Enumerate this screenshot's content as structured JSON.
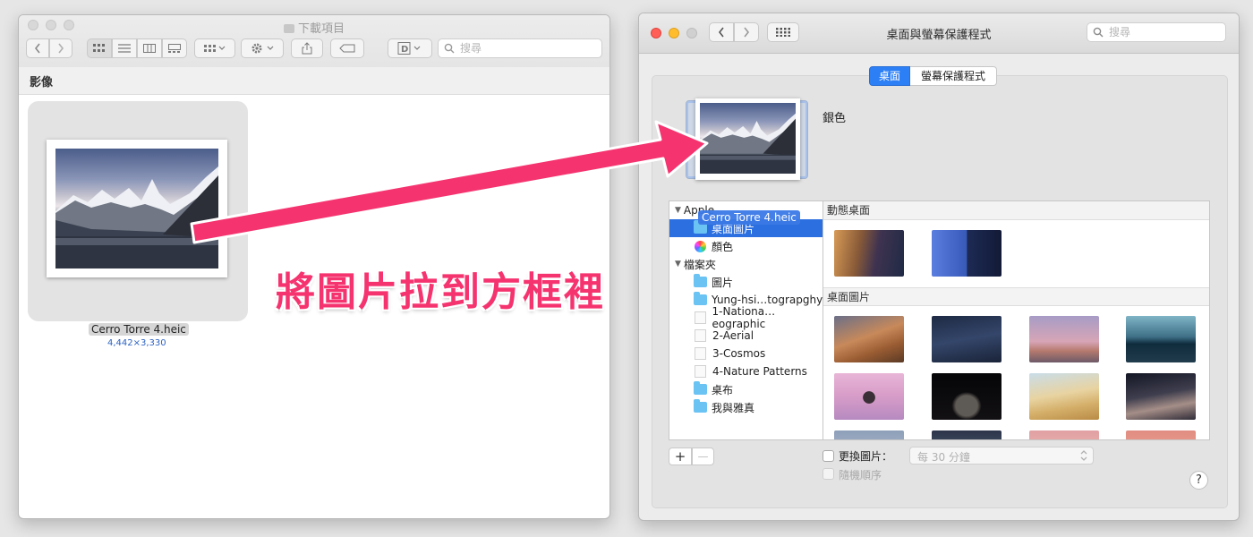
{
  "finder": {
    "title": "下載項目",
    "search_placeholder": "搜尋",
    "path_label": "影像",
    "file": {
      "name": "Cerro Torre 4.heic",
      "dimensions": "4,442×3,330"
    }
  },
  "annotation": {
    "text": "將圖片拉到方框裡",
    "color": "#f5336f"
  },
  "prefs": {
    "title": "桌面與螢幕保護程式",
    "search_placeholder": "搜尋",
    "tabs": [
      {
        "label": "桌面",
        "active": true
      },
      {
        "label": "螢幕保護程式",
        "active": false
      }
    ],
    "current_name": "銀色",
    "drag_label": "Cerro Torre 4.heic",
    "tree": {
      "apple_label": "Apple",
      "apple_children": [
        {
          "label": "桌面圖片",
          "icon": "folder-icon",
          "selected": true
        },
        {
          "label": "顏色",
          "icon": "color-wheel-icon"
        }
      ],
      "folders_label": "檔案夾",
      "folder_children": [
        {
          "label": "圖片",
          "icon": "folder-icon"
        },
        {
          "label": "Yung-hsi…tograpghy",
          "icon": "folder-icon"
        },
        {
          "label": "1-Nationa…eographic",
          "icon": "file-icon"
        },
        {
          "label": "2-Aerial",
          "icon": "file-icon"
        },
        {
          "label": "3-Cosmos",
          "icon": "file-icon"
        },
        {
          "label": "4-Nature Patterns",
          "icon": "file-icon"
        },
        {
          "label": "桌布",
          "icon": "folder-icon"
        },
        {
          "label": "我與雅真",
          "icon": "folder-icon"
        }
      ]
    },
    "sections": {
      "dynamic": "動態桌面",
      "pictures": "桌面圖片"
    },
    "change_picture_label": "更換圖片：",
    "interval_value": "每 30 分鐘",
    "random_order_label": "隨機順序",
    "add_label": "+",
    "remove_label": "—",
    "help_label": "?",
    "accent": "#2c7ff5"
  }
}
